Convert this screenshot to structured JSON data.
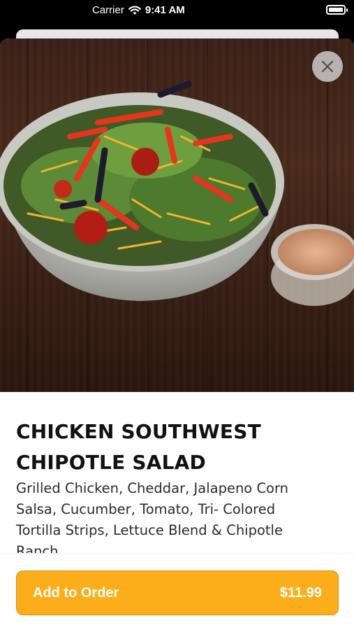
{
  "status_bar": {
    "carrier": "Carrier",
    "time": "9:41 AM",
    "wifi_icon": "wifi-icon",
    "battery_icon": "battery-icon"
  },
  "hero": {
    "image": "chicken southwest chipotle salad bowl with chipotle ranch cup on wooden table",
    "close_icon": "close-icon"
  },
  "item": {
    "title": "CHICKEN SOUTHWEST CHIPOTLE SALAD",
    "description": "Grilled Chicken, Cheddar, Jalapeno Corn Salsa, Cucumber, Tomato, Tri- Colored Tortilla Strips, Lettuce Blend & Chipotle Ranch"
  },
  "footer": {
    "add_label": "Add to Order",
    "price": "$11.99"
  },
  "colors": {
    "accent": "#fbae19",
    "text": "#111111"
  }
}
